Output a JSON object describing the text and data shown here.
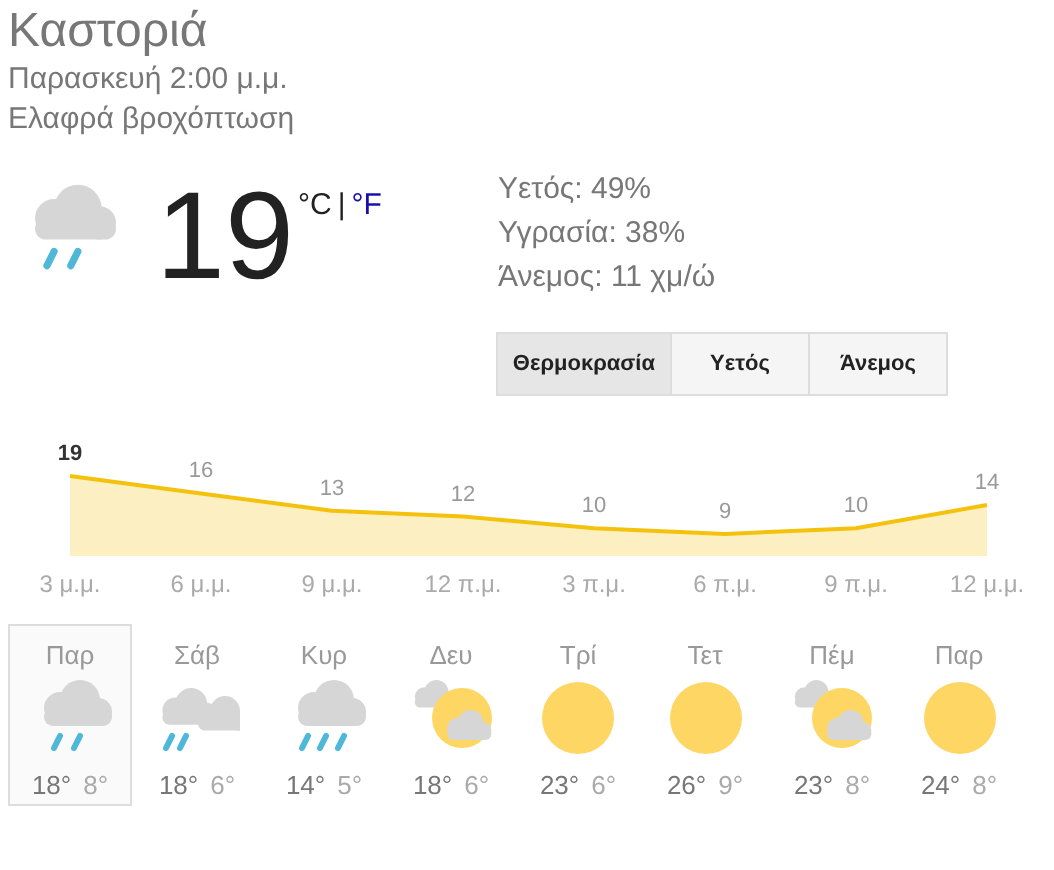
{
  "location": "Καστοριά",
  "datetime": "Παρασκευή 2:00 μ.μ.",
  "condition": "Ελαφρά βροχόπτωση",
  "current": {
    "kind": "rain",
    "temperature": "19",
    "units": [
      {
        "label": "°C",
        "selected": true
      },
      {
        "label": "°F",
        "selected": false
      }
    ],
    "separator": "|"
  },
  "details": [
    "Υετός: 49%",
    "Υγρασία: 38%",
    "Άνεμος: 11 χμ/ώ"
  ],
  "tabs": [
    {
      "label": "Θερμοκρασία",
      "selected": true
    },
    {
      "label": "Υετός",
      "selected": false
    },
    {
      "label": "Άνεμος",
      "selected": false
    }
  ],
  "chart_data": {
    "type": "area",
    "categories": [
      "3 μ.μ.",
      "6 μ.μ.",
      "9 μ.μ.",
      "12 π.μ.",
      "3 π.μ.",
      "6 π.μ.",
      "9 π.μ.",
      "12 μ.μ."
    ],
    "series": [
      {
        "color": "#f4c20d",
        "values": [
          19,
          16,
          13,
          12,
          10,
          9,
          10,
          14
        ]
      }
    ],
    "data_labels": true
  },
  "forecast": [
    {
      "day": "Παρ",
      "kind": "rain",
      "high": "18°",
      "low": "8°",
      "selected": true
    },
    {
      "day": "Σάβ",
      "kind": "rain-clouds",
      "high": "18°",
      "low": "6°",
      "selected": false
    },
    {
      "day": "Κυρ",
      "kind": "heavy-rain",
      "high": "14°",
      "low": "5°",
      "selected": false
    },
    {
      "day": "Δευ",
      "kind": "partly-sunny",
      "high": "18°",
      "low": "6°",
      "selected": false
    },
    {
      "day": "Τρί",
      "kind": "sunny",
      "high": "23°",
      "low": "6°",
      "selected": false
    },
    {
      "day": "Τετ",
      "kind": "sunny",
      "high": "26°",
      "low": "9°",
      "selected": false
    },
    {
      "day": "Πέμ",
      "kind": "partly-sunny",
      "high": "23°",
      "low": "8°",
      "selected": false
    },
    {
      "day": "Παρ",
      "kind": "sunny",
      "high": "24°",
      "low": "8°",
      "selected": false
    }
  ]
}
